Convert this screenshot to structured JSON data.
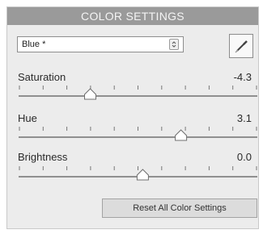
{
  "panel": {
    "title": "COLOR SETTINGS"
  },
  "colorSelect": {
    "value": "Blue *",
    "icon": "up-down-arrows-icon"
  },
  "eyedropperButton": {
    "icon": "eyedropper-icon"
  },
  "sliders": [
    {
      "label": "Saturation",
      "value": "-4.3",
      "fraction": 0.3
    },
    {
      "label": "Hue",
      "value": "3.1",
      "fraction": 0.68
    },
    {
      "label": "Brightness",
      "value": "0.0",
      "fraction": 0.52
    }
  ],
  "resetButton": {
    "label": "Reset All Color Settings"
  }
}
